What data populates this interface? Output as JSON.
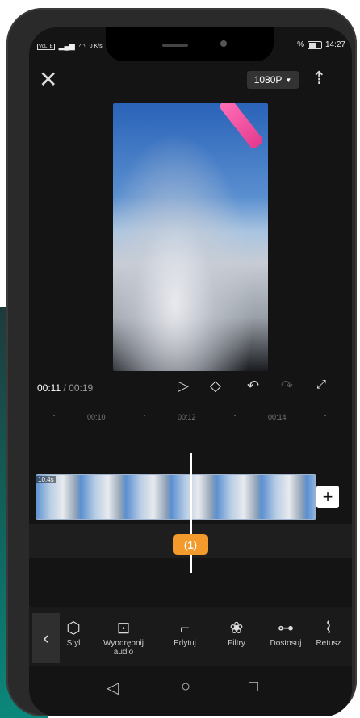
{
  "status": {
    "left_icons": [
      "sim-icon",
      "signal-icon",
      "wifi-icon"
    ],
    "speed": "0 K/s",
    "battery_percent": "%",
    "clock": "14:27"
  },
  "header": {
    "resolution": "1080P",
    "close_icon": "close-icon",
    "export_icon": "export-icon"
  },
  "player": {
    "current_time": "00:11",
    "total_time": "/ 00:19"
  },
  "ruler": {
    "ticks": [
      "00:10",
      "00:12",
      "00:14"
    ]
  },
  "timeline": {
    "clip_duration_label": "10.4s",
    "marker_label": "(1)"
  },
  "toolbar": {
    "items": [
      {
        "label": "Styl",
        "icon": "cube-icon"
      },
      {
        "label": "Wyodrębnij audio",
        "icon": "extract-audio-icon"
      },
      {
        "label": "Edytuj",
        "icon": "crop-icon"
      },
      {
        "label": "Filtry",
        "icon": "filters-icon"
      },
      {
        "label": "Dostosuj",
        "icon": "adjust-icon"
      },
      {
        "label": "Retusz",
        "icon": "retouch-icon"
      }
    ]
  },
  "colors": {
    "accent_marker": "#f29b2c",
    "background": "#141414"
  }
}
